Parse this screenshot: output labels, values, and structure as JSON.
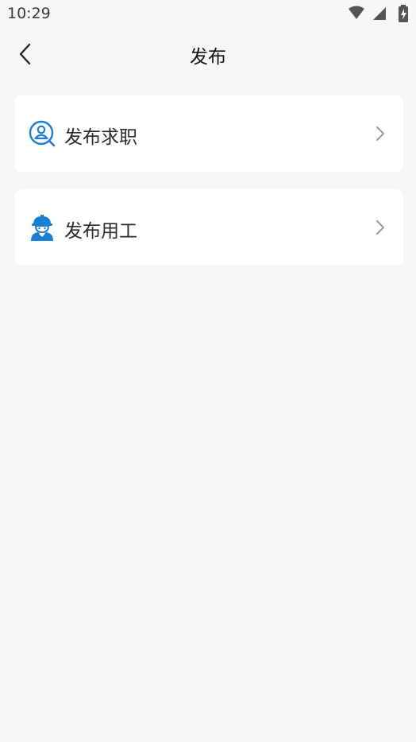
{
  "status_bar": {
    "time": "10:29",
    "icons": [
      "wifi-icon",
      "signal-icon",
      "battery-charging-icon"
    ]
  },
  "header": {
    "title": "发布",
    "back_icon": "chevron-left-icon"
  },
  "menu": {
    "items": [
      {
        "label": "发布求职",
        "icon": "job-seeker-icon",
        "arrow_icon": "chevron-right-icon"
      },
      {
        "label": "发布用工",
        "icon": "worker-helmet-icon",
        "arrow_icon": "chevron-right-icon"
      }
    ]
  },
  "colors": {
    "background": "#f5f6f8",
    "card": "#ffffff",
    "accent_blue": "#1a7fd4",
    "chevron": "#9a9a9a"
  }
}
